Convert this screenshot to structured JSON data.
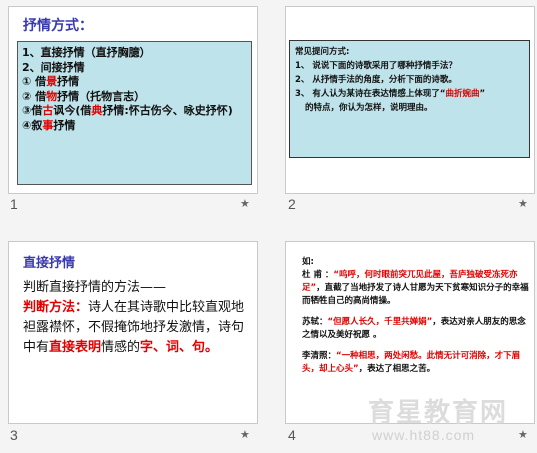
{
  "slides": [
    {
      "number": "1",
      "title": "抒情方式：",
      "lines": [
        "1、直接抒情（直抒胸臆）",
        "2、间接抒情",
        [
          "① 借",
          "景",
          "抒情"
        ],
        [
          "② 借",
          "物",
          "抒情（托物言志）"
        ],
        [
          "③借",
          "古",
          "讽今(借",
          "典",
          "抒情:怀古伤今、咏史抒怀)"
        ],
        [
          "④叙",
          "事",
          "抒情"
        ]
      ]
    },
    {
      "number": "2",
      "heading": "常见提问方式:",
      "q1": "1、 说说下面的诗歌采用了哪种抒情手法？",
      "q2": "2、 从抒情手法的角度，分析下面的诗歌。",
      "q3a": "3、 有人认为某诗在表达情感上体现了“",
      "q3b": "曲折婉曲",
      "q3c": "”",
      "q3d": "的特点，你认为怎样，说明理由。"
    },
    {
      "number": "3",
      "title": "直接抒情",
      "line1": "判断直接抒情的方法——",
      "label": "判断方法：",
      "body1": "诗人在其诗歌中比较直观地袒露襟怀，不假掩饰地抒发激情，诗句中有",
      "body2": "直接表明",
      "body3": "情感的",
      "body4": "字、词、句。"
    },
    {
      "number": "4",
      "label": "如:",
      "p1_author": "杜 甫 ：",
      "p1_quote": "“呜呼，何时眼前突兀见此屋，吾庐独破受冻死亦足”",
      "p1_text": "，直截了当地抒发了诗人甘愿为天下贫寒知识分子的幸福而牺牲自己的高尚情操。",
      "p2_author": "苏轼：",
      "p2_quote": "“但愿人长久，千里共婵娟”",
      "p2_text": "，表达对亲人朋友的思念之情以及美好祝愿 。",
      "p3_author": "李清照：",
      "p3_quote": "“一种相思，两处闲愁。此情无计可消除，才下眉头，却上心头”",
      "p3_text": "，表达了相思之苦。"
    }
  ],
  "watermark": {
    "text": "育星教育网",
    "url": "www.ht88.com"
  },
  "star_icon": "star-icon"
}
